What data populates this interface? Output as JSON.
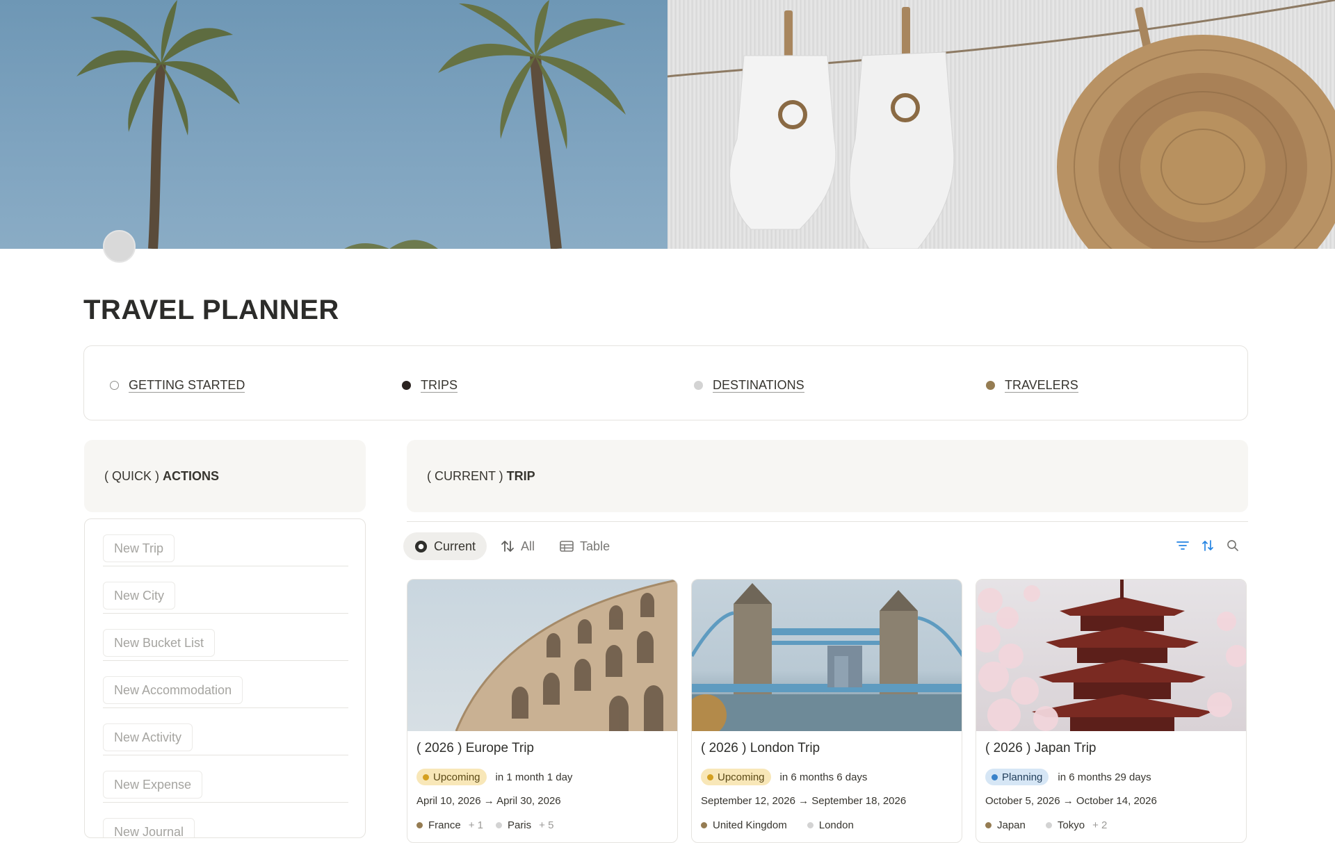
{
  "page": {
    "title": "TRAVEL PLANNER"
  },
  "nav": {
    "items": [
      {
        "label": "GETTING STARTED",
        "dot": "hollow"
      },
      {
        "label": "TRIPS",
        "dot": "#2b2320"
      },
      {
        "label": "DESTINATIONS",
        "dot": "#d3d3d3"
      },
      {
        "label": "TRAVELERS",
        "dot": "#957c52"
      }
    ]
  },
  "quick_actions": {
    "prefix": "( QUICK )",
    "heading": "ACTIONS",
    "buttons": [
      "New Trip",
      "New City",
      "New Bucket List",
      "New Accommodation",
      "New Activity",
      "New Expense",
      "New Journal"
    ]
  },
  "current_trip": {
    "prefix": "( CURRENT )",
    "heading": "TRIP"
  },
  "views": {
    "tabs": [
      {
        "label": "Current",
        "icon": "target-icon",
        "active": true
      },
      {
        "label": "All",
        "icon": "sort-arrows-icon",
        "active": false
      },
      {
        "label": "Table",
        "icon": "table-icon",
        "active": false
      }
    ],
    "tools": [
      "filter-icon",
      "sort-icon",
      "search-icon"
    ]
  },
  "cards": [
    {
      "title": "( 2026 ) Europe Trip",
      "status": "Upcoming",
      "countdown": "in 1 month 1 day",
      "dates": "April 10, 2026 → April 30, 2026",
      "country": "France",
      "country_more": "+ 1",
      "city": "Paris",
      "city_more": "+ 5"
    },
    {
      "title": "( 2026 ) London Trip",
      "status": "Upcoming",
      "countdown": "in 6 months 6 days",
      "dates": "September 12, 2026 → September 18, 2026",
      "country": "United Kingdom",
      "country_more": "",
      "city": "London",
      "city_more": ""
    },
    {
      "title": "( 2026 ) Japan Trip",
      "status": "Planning",
      "countdown": "in 6 months 29 days",
      "dates": "October 5, 2026 → October 14, 2026",
      "country": "Japan",
      "country_more": "",
      "city": "Tokyo",
      "city_more": "+ 2"
    }
  ],
  "colors": {
    "country_dot": "#957c52",
    "city_dot": "#d3d3d3",
    "accent_tools": "#2383e2"
  }
}
